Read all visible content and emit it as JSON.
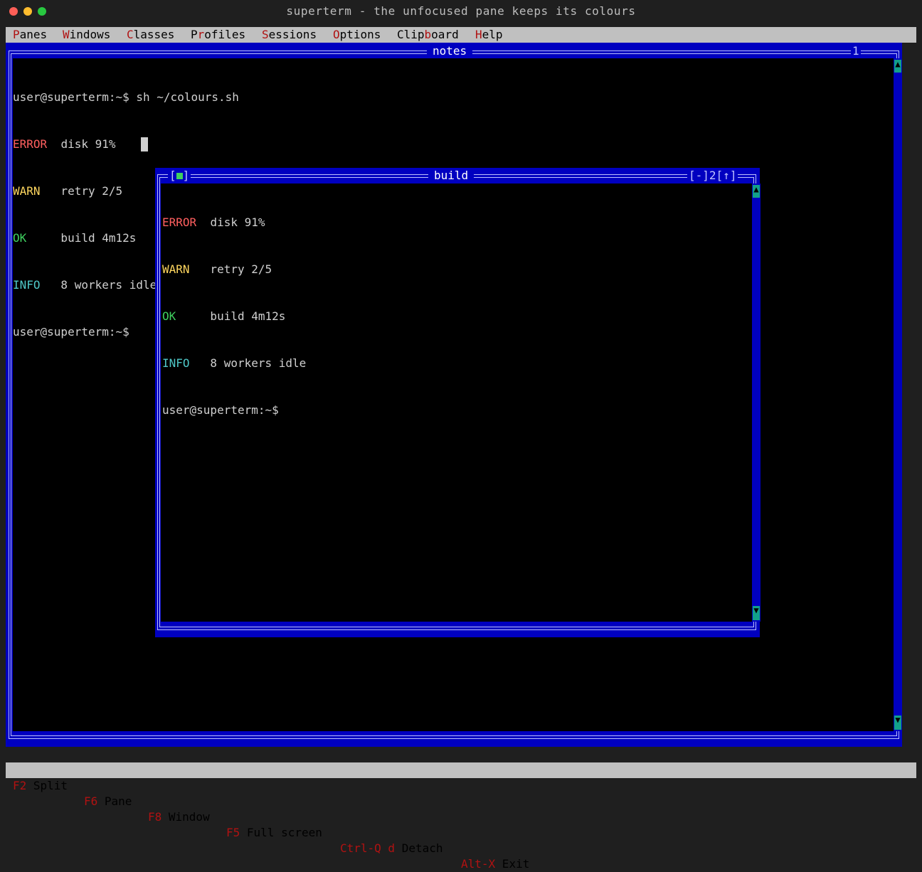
{
  "window": {
    "title": "superterm - the unfocused pane keeps its colours"
  },
  "menu": [
    {
      "hot": "P",
      "rest": "anes",
      "pre": ""
    },
    {
      "hot": "W",
      "rest": "indows",
      "pre": ""
    },
    {
      "hot": "C",
      "rest": "lasses",
      "pre": ""
    },
    {
      "hot": "r",
      "rest": "ofiles",
      "pre": "P"
    },
    {
      "hot": "S",
      "rest": "essions",
      "pre": ""
    },
    {
      "hot": "O",
      "rest": "ptions",
      "pre": ""
    },
    {
      "hot": "b",
      "rest": "oard",
      "pre": "Clip"
    },
    {
      "hot": "H",
      "rest": "elp",
      "pre": ""
    }
  ],
  "notes": {
    "title": "notes",
    "number": "1",
    "lines": [
      {
        "tag": "",
        "text": "user@superterm:~$ sh ~/colours.sh"
      },
      {
        "tag": "ERROR",
        "text": "  disk 91%"
      },
      {
        "tag": "WARN",
        "text": "   retry 2/5"
      },
      {
        "tag": "OK",
        "text": "     build 4m12s"
      },
      {
        "tag": "INFO",
        "text": "   8 workers idle"
      }
    ],
    "prompt": "user@superterm:~$ "
  },
  "build": {
    "title": "build",
    "close": "[■]",
    "minimize": "[-]",
    "number": "2",
    "maximize": "[↑]",
    "lines": [
      {
        "tag": "ERROR",
        "text": "  disk 91%"
      },
      {
        "tag": "WARN",
        "text": "   retry 2/5"
      },
      {
        "tag": "OK",
        "text": "     build 4m12s"
      },
      {
        "tag": "INFO",
        "text": "   8 workers idle"
      }
    ],
    "prompt": "user@superterm:~$"
  },
  "status": [
    {
      "key": "F2",
      "label": " Split"
    },
    {
      "key": "F6",
      "label": " Pane"
    },
    {
      "key": "F8",
      "label": " Window"
    },
    {
      "key": "F5",
      "label": " Full screen"
    },
    {
      "key": "Ctrl-Q d",
      "label": " Detach"
    },
    {
      "key": "Alt-X",
      "label": " Exit"
    }
  ],
  "colors": {
    "error": "#ff5f5f",
    "warn": "#ffd75f",
    "ok": "#3fd05f",
    "info": "#4fc8c8",
    "frame": "#0000c0",
    "menubar": "#c0c0c0",
    "hotkey": "#b01212"
  }
}
